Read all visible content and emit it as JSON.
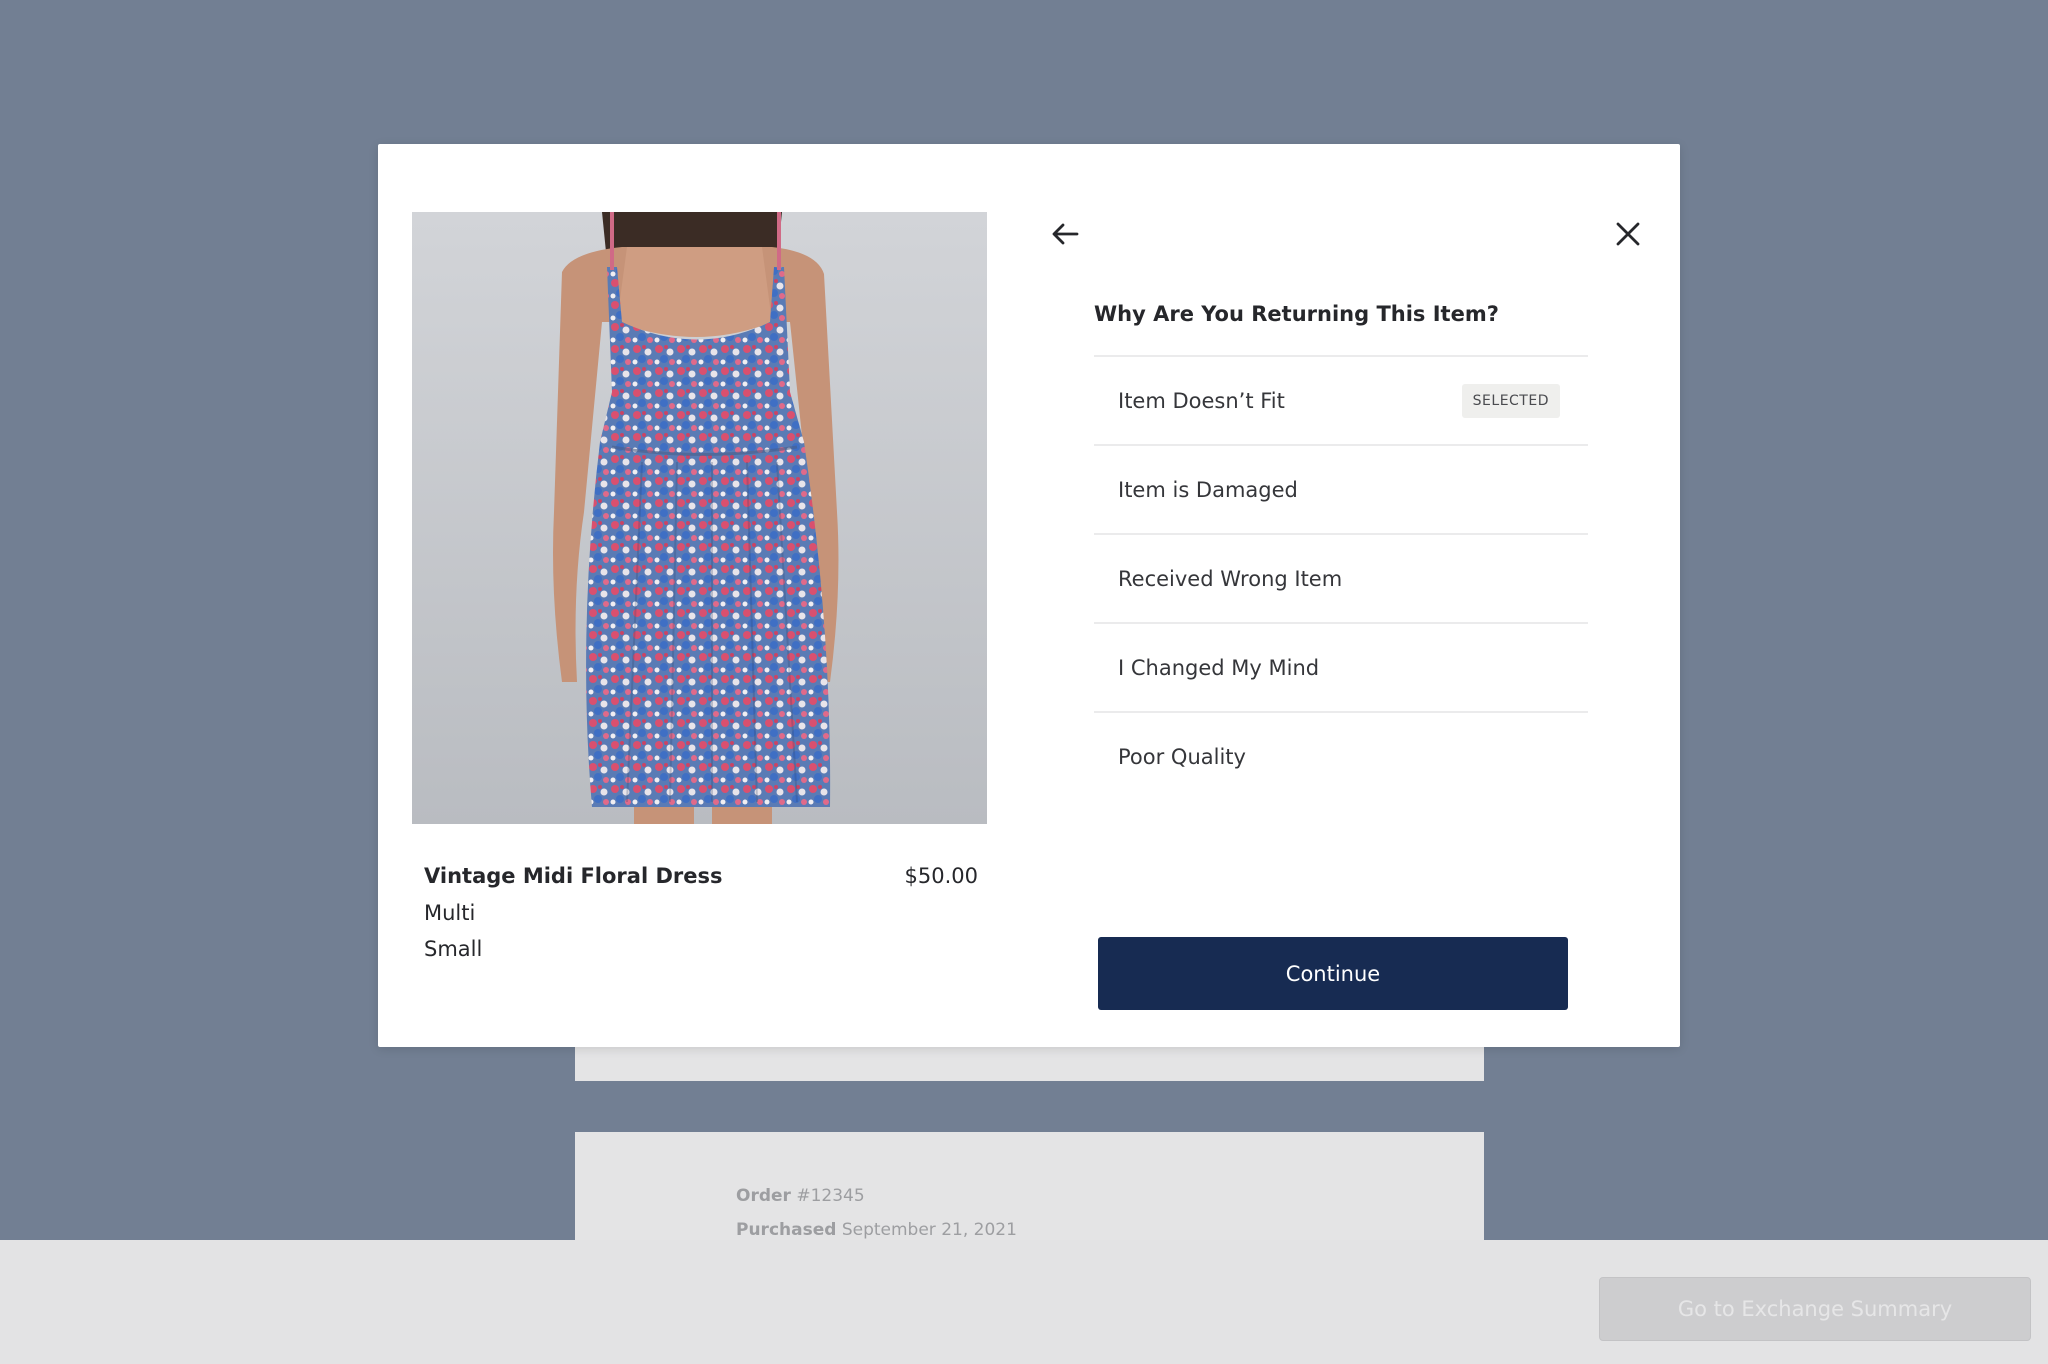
{
  "background": {
    "order": {
      "number_label": "Order",
      "number_value": "#12345",
      "purchased_label": "Purchased",
      "purchased_value": "September 21, 2021"
    },
    "exchange_button_label": "Go to Exchange Summary"
  },
  "modal": {
    "product": {
      "image_icon": "floral-dress-photo",
      "name": "Vintage Midi Floral Dress",
      "price": "$50.00",
      "color": "Multi",
      "size": "Small"
    },
    "question": "Why Are You Returning This Item?",
    "reasons": [
      {
        "label": "Item Doesn’t Fit",
        "selected": true
      },
      {
        "label": "Item is Damaged",
        "selected": false
      },
      {
        "label": "Received Wrong Item",
        "selected": false
      },
      {
        "label": "I Changed My Mind",
        "selected": false
      },
      {
        "label": "Poor Quality",
        "selected": false
      }
    ],
    "selected_badge": "SELECTED",
    "continue_label": "Continue",
    "icons": {
      "back": "arrow-left-icon",
      "close": "close-icon"
    }
  },
  "colors": {
    "overlay": "#727f93",
    "primary_button": "#172b52",
    "badge_bg": "#efefed"
  }
}
